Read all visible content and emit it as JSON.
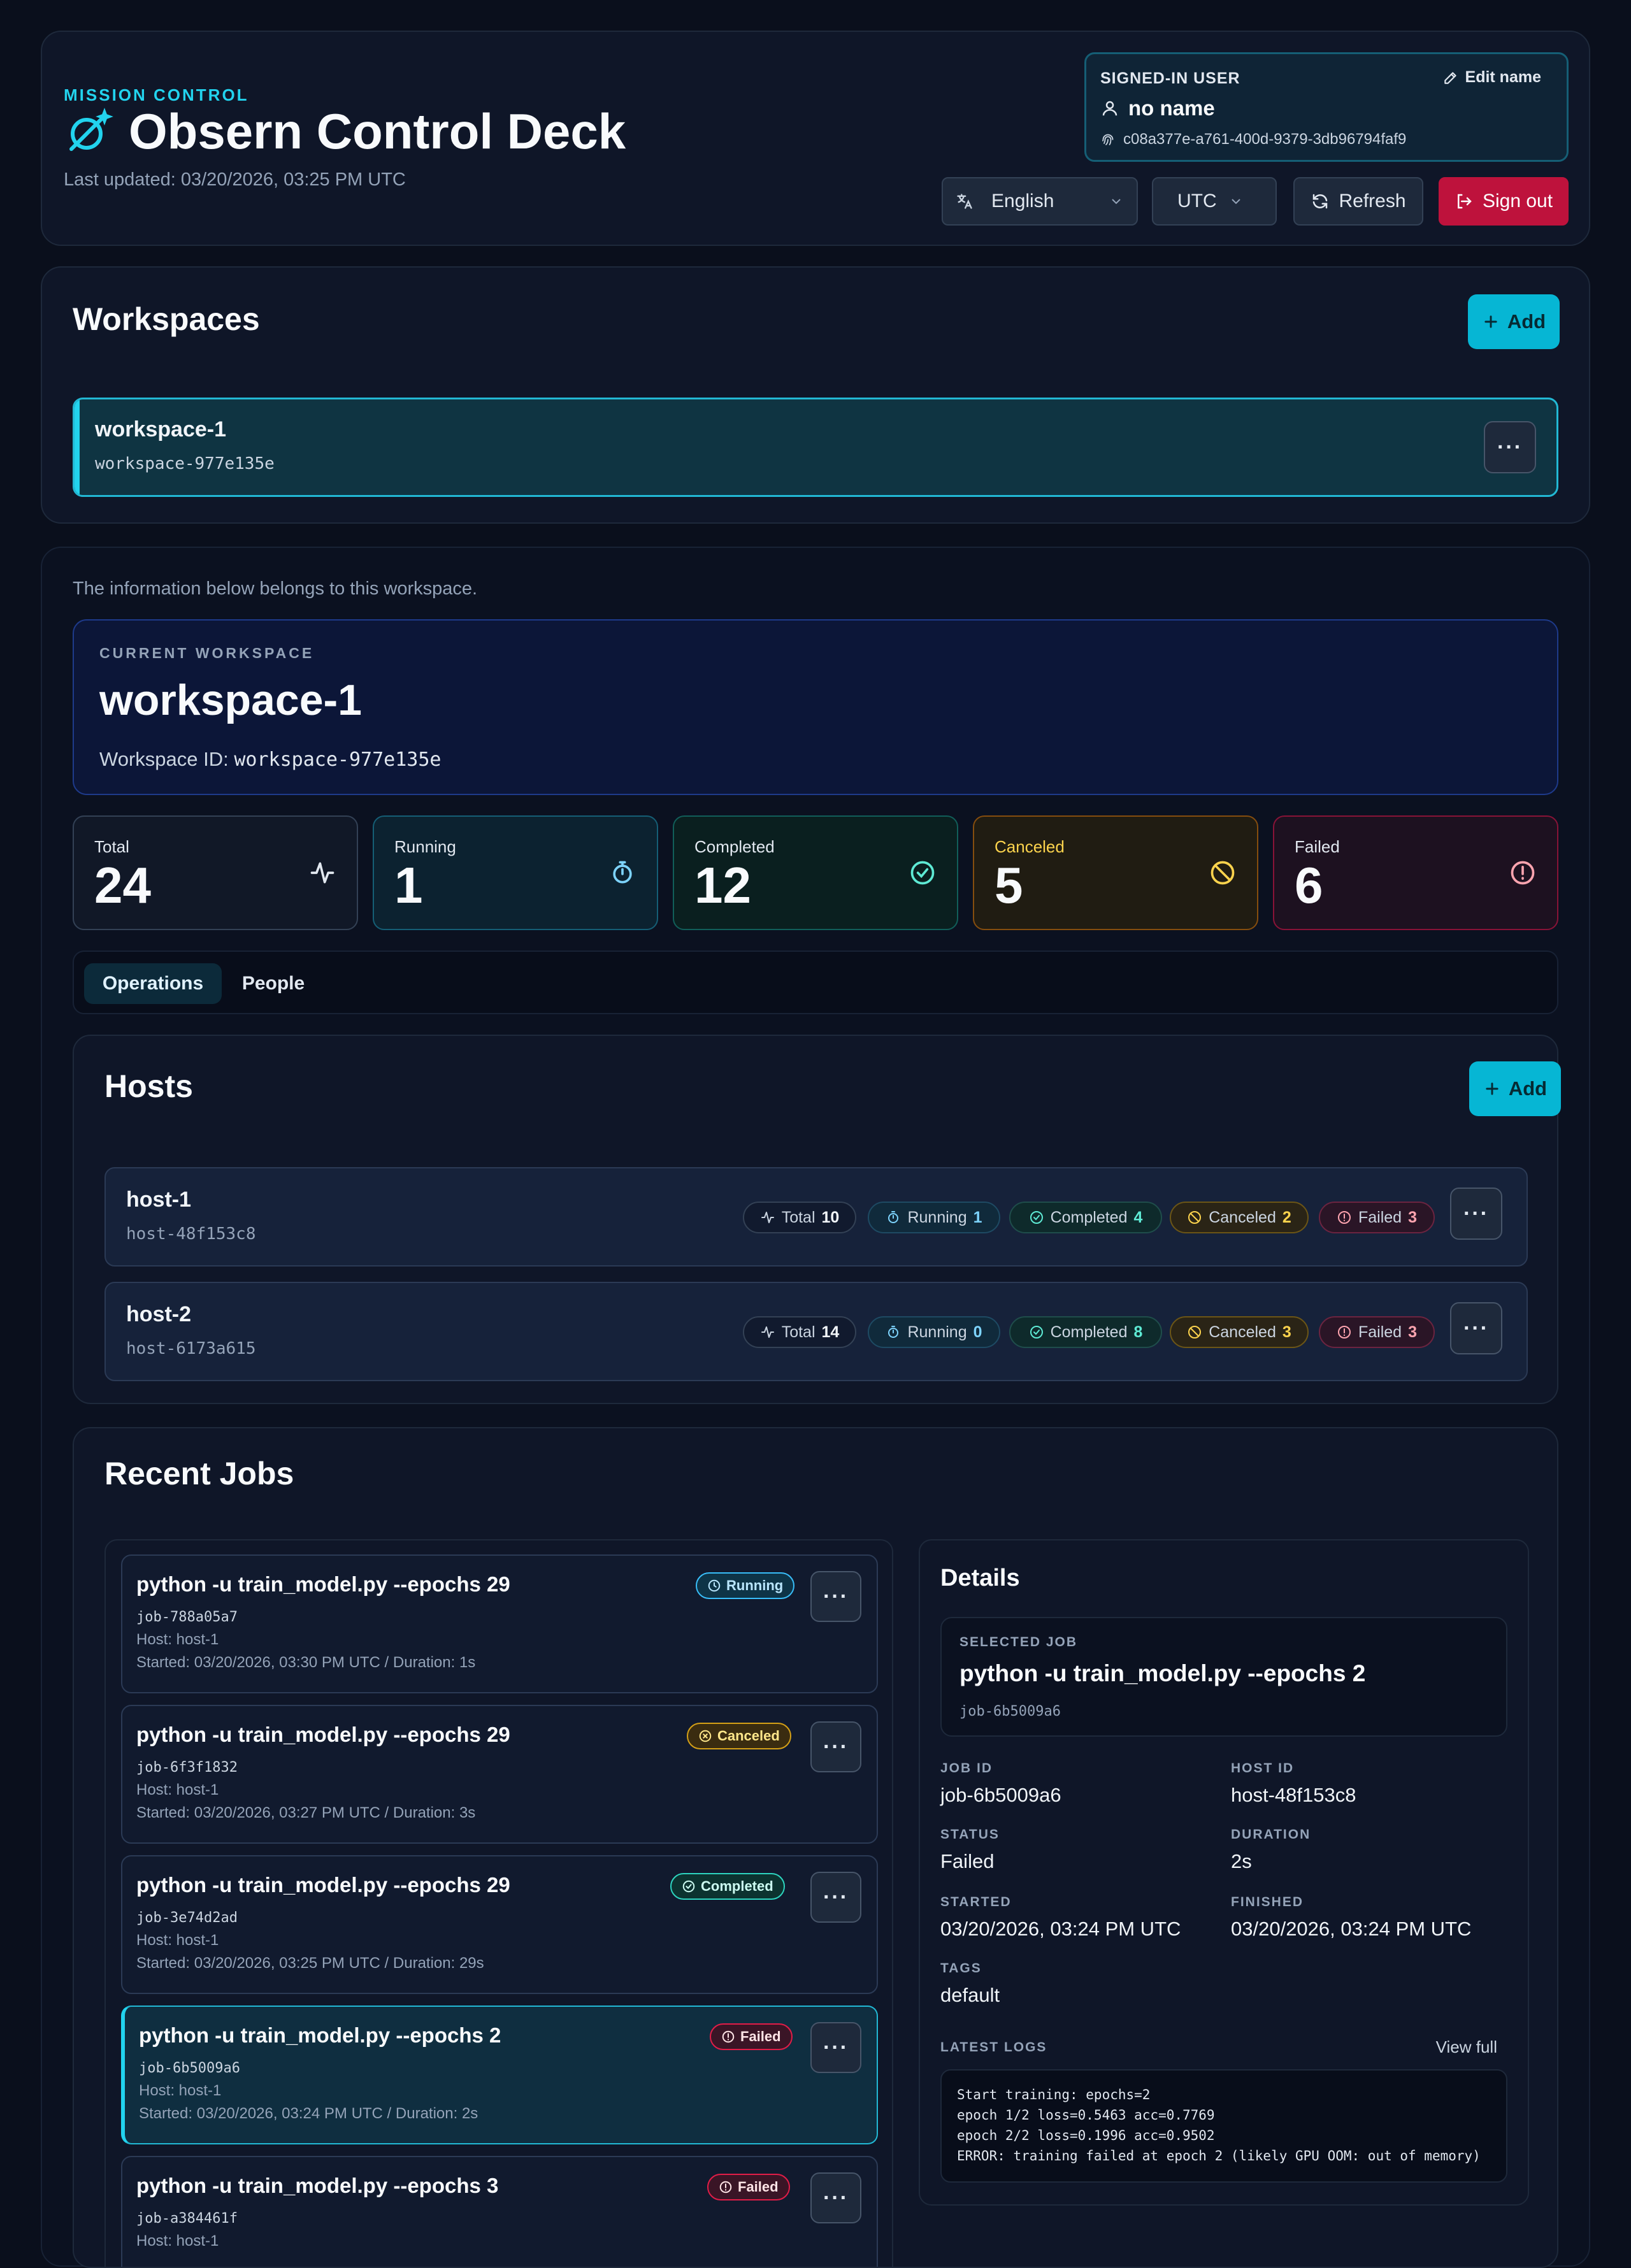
{
  "header": {
    "eyebrow": "MISSION CONTROL",
    "title": "Obsern Control Deck",
    "last_updated": "Last updated: 03/20/2026, 03:25 PM UTC",
    "user": {
      "label": "SIGNED-IN USER",
      "edit_label": "Edit name",
      "name": "no name",
      "id": "c08a377e-a761-400d-9379-3db96794faf9"
    },
    "language": "English",
    "timezone": "UTC",
    "refresh_label": "Refresh",
    "signout_label": "Sign out"
  },
  "workspaces": {
    "title": "Workspaces",
    "add_label": "Add",
    "items": [
      {
        "name": "workspace-1",
        "id": "workspace-977e135e",
        "more": "···"
      }
    ]
  },
  "current": {
    "note": "The information below belongs to this workspace.",
    "label": "CURRENT WORKSPACE",
    "name": "workspace-1",
    "id_label": "Workspace ID:",
    "id": "workspace-977e135e"
  },
  "stats": {
    "total": {
      "label": "Total",
      "value": "24"
    },
    "running": {
      "label": "Running",
      "value": "1"
    },
    "completed": {
      "label": "Completed",
      "value": "12"
    },
    "canceled": {
      "label": "Canceled",
      "value": "5"
    },
    "failed": {
      "label": "Failed",
      "value": "6"
    }
  },
  "tabs": {
    "operations": "Operations",
    "people": "People"
  },
  "hosts": {
    "title": "Hosts",
    "add_label": "Add",
    "pill_labels": {
      "total": "Total",
      "running": "Running",
      "completed": "Completed",
      "canceled": "Canceled",
      "failed": "Failed"
    },
    "items": [
      {
        "name": "host-1",
        "id": "host-48f153c8",
        "total": "10",
        "running": "1",
        "completed": "4",
        "canceled": "2",
        "failed": "3"
      },
      {
        "name": "host-2",
        "id": "host-6173a615",
        "total": "14",
        "running": "0",
        "completed": "8",
        "canceled": "3",
        "failed": "3"
      }
    ]
  },
  "jobs": {
    "title": "Recent Jobs",
    "items": [
      {
        "cmd": "python -u train_model.py --epochs 29",
        "id": "job-788a05a7",
        "host": "Host: host-1",
        "started": "Started: 03/20/2026, 03:30 PM UTC / Duration: 1s",
        "status": "Running"
      },
      {
        "cmd": "python -u train_model.py --epochs 29",
        "id": "job-6f3f1832",
        "host": "Host: host-1",
        "started": "Started: 03/20/2026, 03:27 PM UTC / Duration: 3s",
        "status": "Canceled"
      },
      {
        "cmd": "python -u train_model.py --epochs 29",
        "id": "job-3e74d2ad",
        "host": "Host: host-1",
        "started": "Started: 03/20/2026, 03:25 PM UTC / Duration: 29s",
        "status": "Completed"
      },
      {
        "cmd": "python -u train_model.py --epochs 2",
        "id": "job-6b5009a6",
        "host": "Host: host-1",
        "started": "Started: 03/20/2026, 03:24 PM UTC / Duration: 2s",
        "status": "Failed"
      },
      {
        "cmd": "python -u train_model.py --epochs 3",
        "id": "job-a384461f",
        "host": "Host: host-1",
        "started": "",
        "status": "Failed"
      }
    ]
  },
  "details": {
    "title": "Details",
    "selected_label": "SELECTED JOB",
    "selected_cmd": "python -u train_model.py --epochs 2",
    "selected_id": "job-6b5009a6",
    "fields": {
      "job_id": {
        "k": "JOB ID",
        "v": "job-6b5009a6"
      },
      "host_id": {
        "k": "HOST ID",
        "v": "host-48f153c8"
      },
      "status": {
        "k": "STATUS",
        "v": "Failed"
      },
      "duration": {
        "k": "DURATION",
        "v": "2s"
      },
      "started": {
        "k": "STARTED",
        "v": "03/20/2026, 03:24 PM UTC"
      },
      "finished": {
        "k": "FINISHED",
        "v": "03/20/2026, 03:24 PM UTC"
      },
      "tags": {
        "k": "TAGS",
        "v": "default"
      }
    },
    "logs_label": "LATEST LOGS",
    "view_full": "View full",
    "logs": [
      "Start training: epochs=2",
      "epoch 1/2 loss=0.5463 acc=0.7769",
      "epoch 2/2 loss=0.1996 acc=0.9502",
      "ERROR: training failed at epoch 2 (likely GPU OOM: out of memory)"
    ]
  },
  "colors": {
    "accent": "#06b6d4",
    "danger": "#be123c",
    "background": "#0a0f1c"
  }
}
